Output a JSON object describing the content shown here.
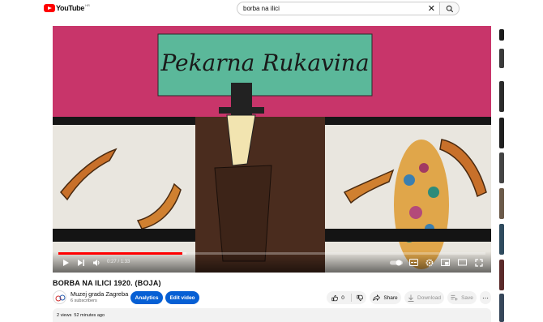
{
  "header": {
    "logo_text": "YouTube",
    "logo_country": "HR",
    "search_value": "borba na ilici",
    "clear_icon": "close-icon",
    "search_icon": "search-icon"
  },
  "video": {
    "time_current": "0:27",
    "time_total": "1:33",
    "progress_fraction": 0.29,
    "loaded_fraction": 0.3,
    "sign_text": "Pekarna Rukavina",
    "control_icons": [
      "play-icon",
      "next-icon",
      "volume-icon",
      "autoplay-toggle",
      "subtitles-icon",
      "settings-icon",
      "miniplayer-icon",
      "theater-icon",
      "fullscreen-icon"
    ]
  },
  "info": {
    "title": "BORBA NA ILICI 1920. (BOJA)",
    "channel_name": "Muzej grada Zagreba",
    "subscribers": "6 subscribers",
    "analytics_label": "Analytics",
    "edit_label": "Edit video",
    "like_count": "0",
    "share_label": "Share",
    "download_label": "Download",
    "save_label": "Save"
  },
  "description": {
    "views": "2 views",
    "age": "52 minutes ago"
  },
  "colors": {
    "brand_red": "#ff0000",
    "accent_blue": "#065fd4"
  }
}
